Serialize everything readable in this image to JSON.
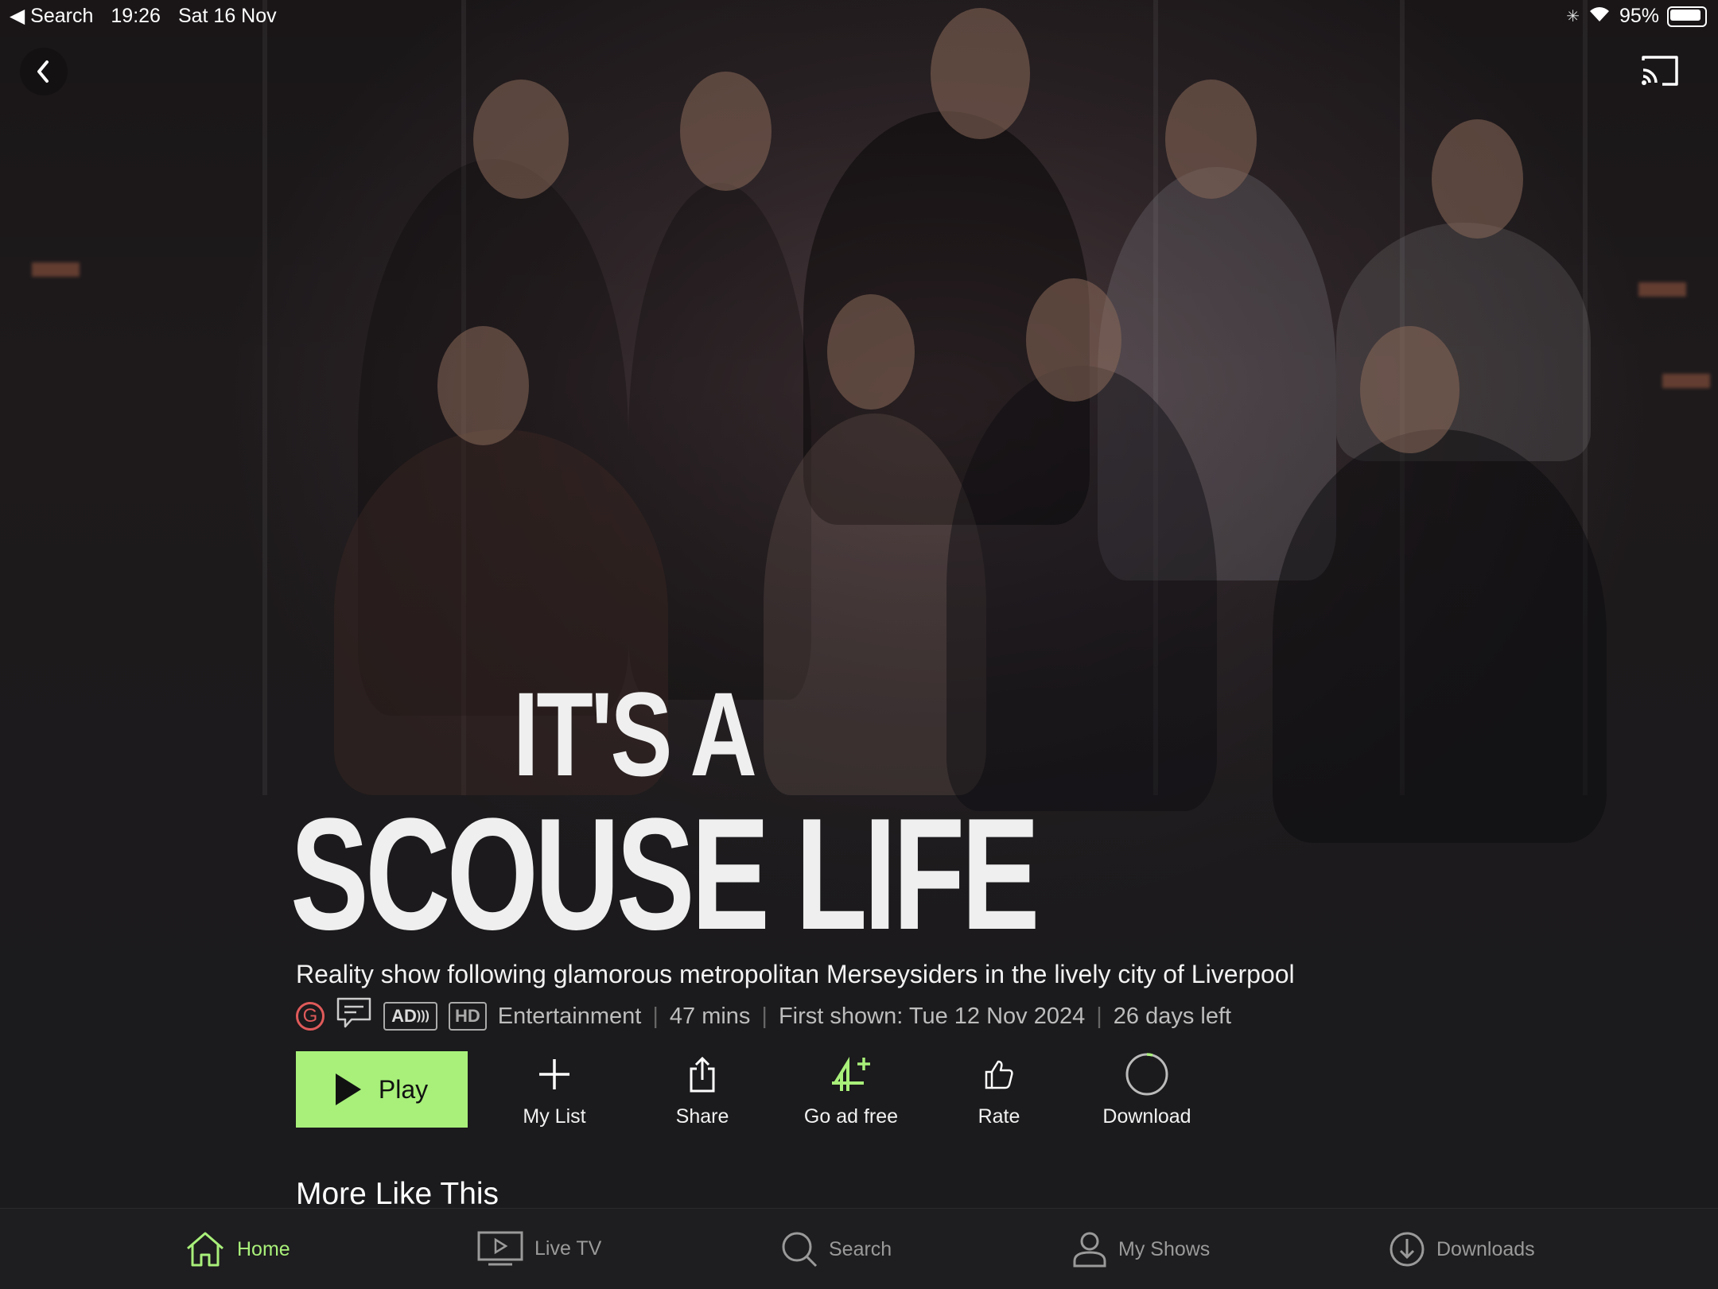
{
  "status_bar": {
    "back_app": "◀ Search",
    "time": "19:26",
    "date": "Sat 16 Nov",
    "battery": "95%"
  },
  "show": {
    "title_line1": "IT'S A",
    "title_line2": "SCOUSE LIFE",
    "description": "Reality show following glamorous metropolitan Merseysiders in the lively city of Liverpool",
    "rating": "G",
    "badge_ad": "AD",
    "badge_hd": "HD",
    "genre": "Entertainment",
    "duration": "47 mins",
    "first_shown": "First shown: Tue 12 Nov 2024",
    "days_left": "26 days left",
    "separator": "|"
  },
  "actions": {
    "play": "Play",
    "my_list": "My List",
    "share": "Share",
    "go_ad_free": "Go ad free",
    "rate": "Rate",
    "download": "Download"
  },
  "sections": {
    "more_like_this": "More Like This"
  },
  "tabbar": {
    "home": "Home",
    "live_tv": "Live TV",
    "search": "Search",
    "my_shows": "My Shows",
    "downloads": "Downloads"
  },
  "colors": {
    "accent": "#a8f07a",
    "background": "#1b1a1c",
    "rating_g": "#e05a5a"
  }
}
